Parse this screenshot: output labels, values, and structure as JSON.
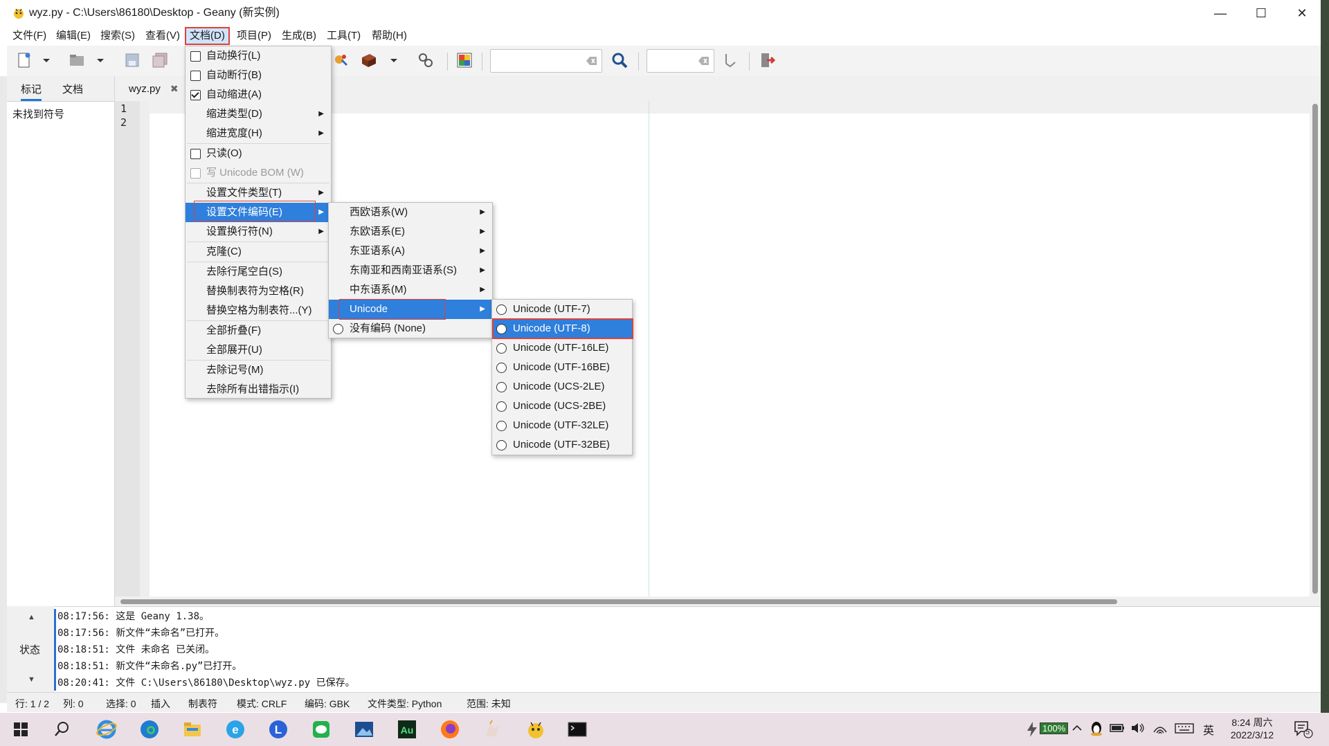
{
  "window": {
    "title": "wyz.py - C:\\Users\\86180\\Desktop - Geany (新实例)",
    "buttons": {
      "minimize": "—",
      "maximize": "☐",
      "close": "✕"
    }
  },
  "menubar": {
    "items": [
      "文件(F)",
      "编辑(E)",
      "搜索(S)",
      "查看(V)",
      "文档(D)",
      "项目(P)",
      "生成(B)",
      "工具(T)",
      "帮助(H)"
    ],
    "active": "文档(D)"
  },
  "sidebar": {
    "tabs": [
      "标记",
      "文档"
    ],
    "active_tab": "标记",
    "empty_text": "未找到符号"
  },
  "editor": {
    "tab_label": "wyz.py",
    "tab_close": "✖",
    "line_numbers": [
      "1",
      "2"
    ]
  },
  "document_menu": {
    "items": [
      {
        "label": "自动换行(L)",
        "check": false
      },
      {
        "label": "自动断行(B)",
        "check": false
      },
      {
        "label": "自动缩进(A)",
        "check": true
      },
      {
        "label": "缩进类型(D)",
        "submenu": true
      },
      {
        "label": "缩进宽度(H)",
        "submenu": true
      },
      {
        "label": "只读(O)",
        "check": false
      },
      {
        "label": "写 Unicode BOM (W)",
        "check": false,
        "disabled": true
      },
      {
        "label": "设置文件类型(T)",
        "submenu": true
      },
      {
        "label": "设置文件编码(E)",
        "submenu": true,
        "highlighted": true
      },
      {
        "label": "设置换行符(N)",
        "submenu": true
      },
      {
        "label": "克隆(C)"
      },
      {
        "label": "去除行尾空白(S)"
      },
      {
        "label": "替换制表符为空格(R)"
      },
      {
        "label": "替换空格为制表符...(Y)"
      },
      {
        "label": "全部折叠(F)"
      },
      {
        "label": "全部展开(U)"
      },
      {
        "label": "去除记号(M)"
      },
      {
        "label": "去除所有出错指示(I)"
      }
    ]
  },
  "encoding_menu": {
    "items": [
      {
        "label": "西欧语系(W)",
        "submenu": true
      },
      {
        "label": "东欧语系(E)",
        "submenu": true
      },
      {
        "label": "东亚语系(A)",
        "submenu": true
      },
      {
        "label": "东南亚和西南亚语系(S)",
        "submenu": true
      },
      {
        "label": "中东语系(M)",
        "submenu": true
      },
      {
        "label": "Unicode",
        "submenu": true,
        "highlighted": true
      },
      {
        "label": "没有编码 (None)",
        "radio": true
      }
    ]
  },
  "unicode_menu": {
    "items": [
      "Unicode (UTF-7)",
      "Unicode (UTF-8)",
      "Unicode (UTF-16LE)",
      "Unicode (UTF-16BE)",
      "Unicode (UCS-2LE)",
      "Unicode (UCS-2BE)",
      "Unicode (UTF-32LE)",
      "Unicode (UTF-32BE)"
    ],
    "highlighted": "Unicode (UTF-8)"
  },
  "messages": {
    "label": "状态",
    "lines": [
      "08:17:56: 这是 Geany 1.38。",
      "08:17:56: 新文件“未命名”已打开。",
      "08:18:51: 文件 未命名 已关闭。",
      "08:18:51: 新文件“未命名.py”已打开。",
      "08:20:41: 文件 C:\\Users\\86180\\Desktop\\wyz.py 已保存。"
    ]
  },
  "statusbar": {
    "line": "行: 1 / 2",
    "col": "列: 0",
    "sel": "选择: 0",
    "mode_ins": "插入",
    "indent": "制表符",
    "eol": "模式: CRLF",
    "enc": "编码: GBK",
    "filetype": "文件类型: Python",
    "scope": "范围: 未知"
  },
  "taskbar": {
    "battery": "100%",
    "ime": "英",
    "time": "8:24 周六",
    "date": "2022/3/12",
    "notif_count": "5"
  },
  "colors": {
    "menu_highlight": "#2f7fdc",
    "red_outline": "#e0403a",
    "message_bar": "#2b6fd1"
  }
}
